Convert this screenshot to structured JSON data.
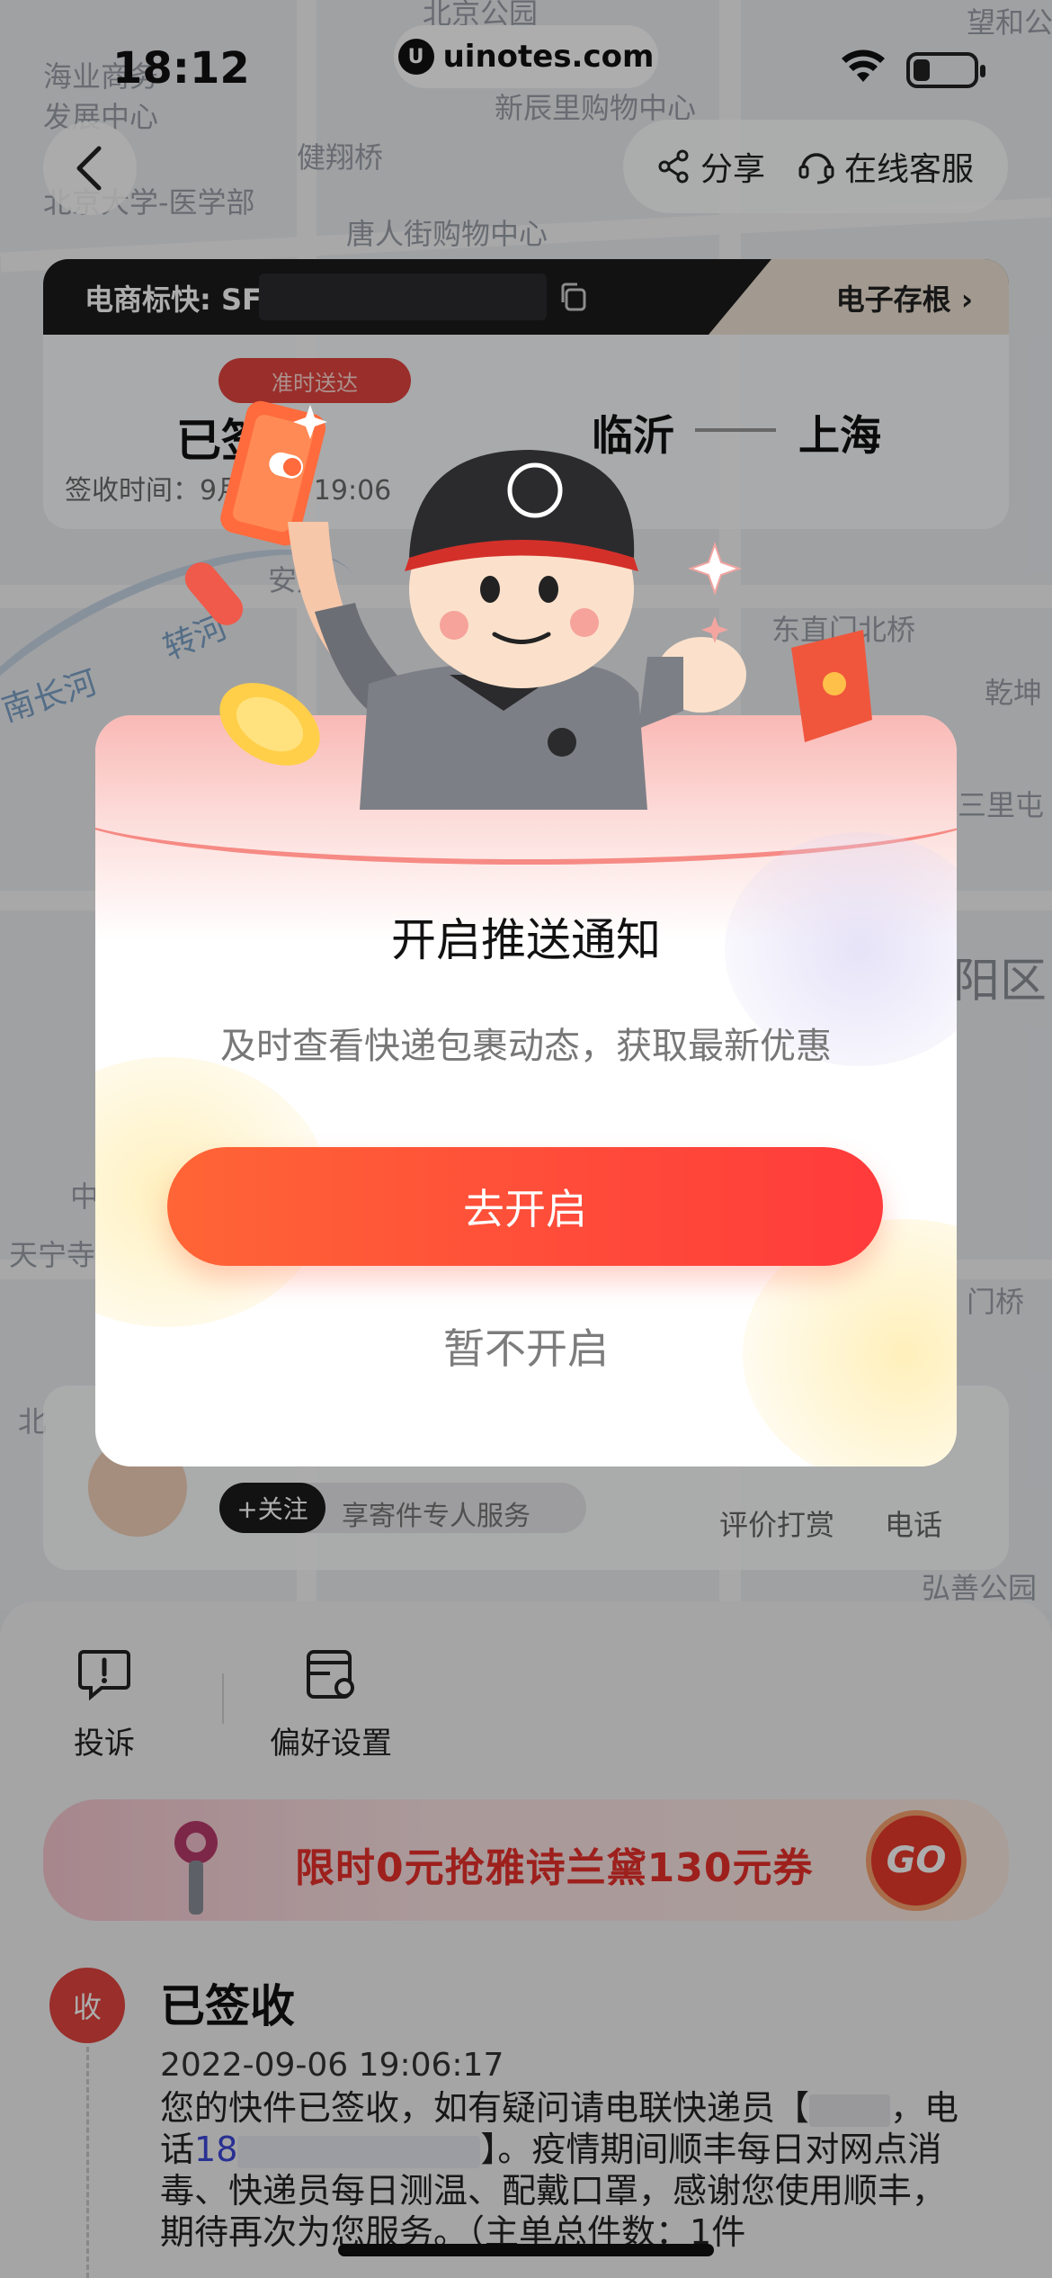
{
  "status_bar": {
    "time": "18:12",
    "watermark": "uinotes.com"
  },
  "map_labels": {
    "l1": "海业商务",
    "l2": "发展中心",
    "l3": "北京大学-医学部",
    "l4": "健翔桥",
    "l5": "新辰里购物中心",
    "l6": "唐人街购物中心",
    "l7": "北京公园",
    "l8": "望和公",
    "l9": "安定",
    "l10": "转河",
    "l11": "南长河",
    "l12": "东直门北桥",
    "l13": "乾坤",
    "l14": "三里屯",
    "l15": "阳区",
    "l16": "天宁寺",
    "l17": "门桥",
    "l18": "弘善公园",
    "l19": "中",
    "l20": "北"
  },
  "nav": {
    "share_label": "分享",
    "service_label": "在线客服"
  },
  "tracking": {
    "waybill_label": "电商标快: SF",
    "stub_label": "电子存根",
    "tag": "准时送达",
    "status": "已签收",
    "sign_time": "签收时间：9月06日 19:06",
    "from": "临沂",
    "to": "上海"
  },
  "courier": {
    "follow_label": "+关注",
    "service_text": "享寄件专人服务",
    "rate_label": "评价打赏",
    "call_label": "电话"
  },
  "tools": {
    "complaint": "投诉",
    "preferences": "偏好设置"
  },
  "promo": {
    "text": "限时0元抢雅诗兰黛130元券",
    "go": "GO"
  },
  "timeline": {
    "badge": "收",
    "title": "已签收",
    "date": "2022-09-06 19:06:17",
    "text_1": "您的快件已签收，如有疑问请电联快递员【",
    "text_2": "，电话",
    "phone": "18",
    "text_3": "】。疫情期间顺丰每日对网点消毒、快递员每日测温、配戴口罩，感谢您使用顺丰，期待再次为您服务。",
    "text_4": "（主单总件数：1件"
  },
  "modal": {
    "title": "开启推送通知",
    "subtitle": "及时查看快递包裹动态，获取最新优惠",
    "primary_button": "去开启",
    "secondary_button": "暂不开启"
  },
  "colors": {
    "accent": "#ff4a3a",
    "tag": "#e2443e",
    "promo_text": "#e8302c"
  }
}
